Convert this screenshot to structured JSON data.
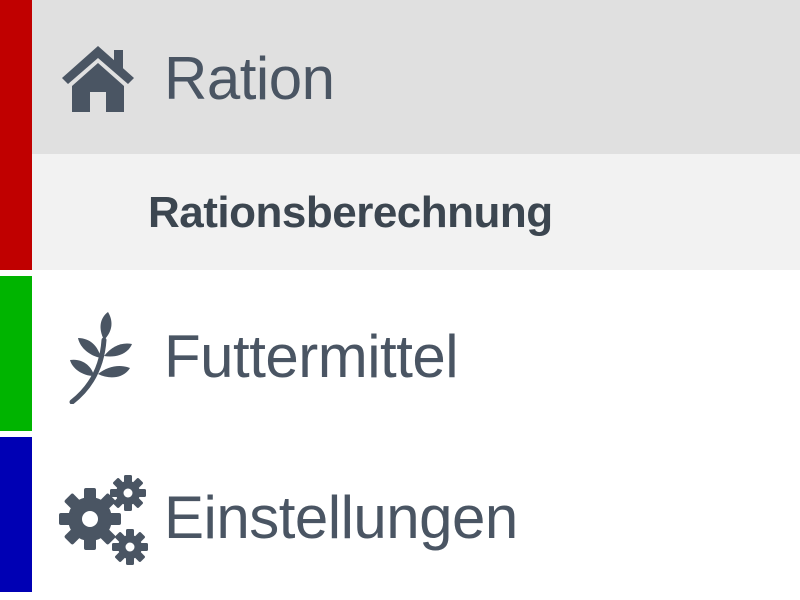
{
  "colors": {
    "accent_ration": "#c00000",
    "accent_futtermittel": "#00b400",
    "accent_einstellungen": "#0000b4",
    "active_row_bg": "#e0e0e0",
    "sub_row_bg": "#f2f2f2",
    "text": "#4a5563"
  },
  "menu": {
    "ration": {
      "label": "Ration",
      "icon": "home-icon",
      "submenu": {
        "rationsberechnung": {
          "label": "Rationsberechnung"
        }
      }
    },
    "futtermittel": {
      "label": "Futtermittel",
      "icon": "leaf-icon"
    },
    "einstellungen": {
      "label": "Einstellungen",
      "icon": "gears-icon"
    }
  }
}
